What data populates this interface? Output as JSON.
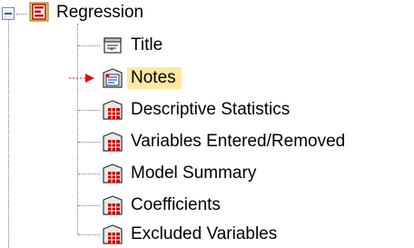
{
  "tree": {
    "root": {
      "label": "Regression",
      "icon": "log-book-icon",
      "expanded": true
    },
    "items": [
      {
        "label": "Title",
        "icon": "title-icon",
        "selected": false
      },
      {
        "label": "Notes",
        "icon": "notes-icon",
        "selected": true
      },
      {
        "label": "Descriptive Statistics",
        "icon": "pivot-table-icon",
        "selected": false
      },
      {
        "label": "Variables Entered/Removed",
        "icon": "pivot-table-icon",
        "selected": false
      },
      {
        "label": "Model Summary",
        "icon": "pivot-table-icon",
        "selected": false
      },
      {
        "label": "Coefficients",
        "icon": "pivot-table-icon",
        "selected": false
      },
      {
        "label": "Excluded Variables",
        "icon": "pivot-table-icon",
        "selected": false
      }
    ]
  },
  "colors": {
    "selection": "#fde8a5",
    "marker_arrow": "#e01010",
    "table_icon_red": "#c00000",
    "connector": "#808080"
  }
}
